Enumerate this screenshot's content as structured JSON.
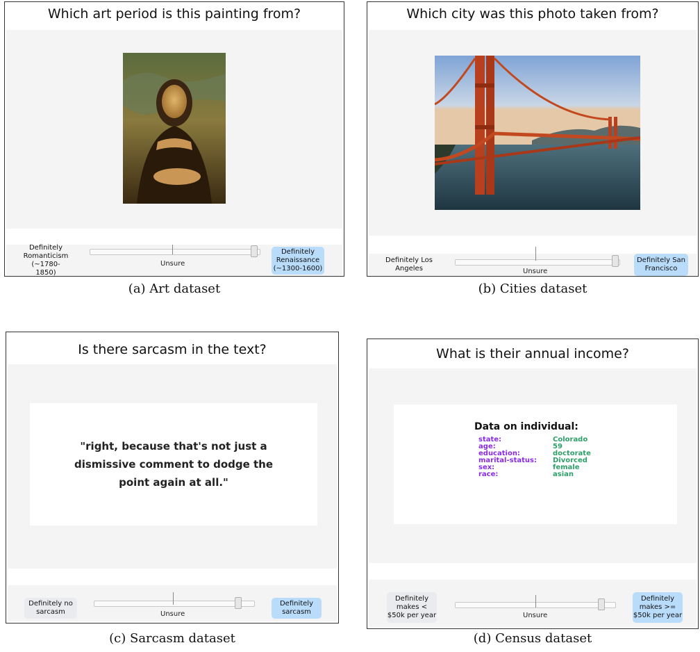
{
  "panels": [
    {
      "id": "art",
      "title": "Which art period is this painting from?",
      "left_label": "Definitely Romanticism (~1780-1850)",
      "right_label": "Definitely Renaissance (~1300-1600)",
      "center_label": "Unsure",
      "slider_value": 0.98,
      "caption": "(a) Art dataset",
      "image_semantic": "painting-mona-lisa"
    },
    {
      "id": "cities",
      "title": "Which city was this photo taken from?",
      "left_label": "Definitely Los Angeles",
      "right_label": "Definitely San Francisco",
      "center_label": "Unsure",
      "slider_value": 0.98,
      "caption": "(b) Cities dataset",
      "image_semantic": "photo-golden-gate-bridge"
    },
    {
      "id": "sarcasm",
      "title": "Is there sarcasm in the text?",
      "left_label": "Definitely no sarcasm",
      "right_label": "Definitely sarcasm",
      "center_label": "Unsure",
      "slider_value": 0.92,
      "caption": "(c) Sarcasm dataset",
      "text": "\"right, because that's not just a dismissive comment to dodge the point again at all.\""
    },
    {
      "id": "census",
      "title": "What is their annual income?",
      "left_label": "Definitely makes < $50k per year",
      "right_label": "Definitely makes >= $50k per year",
      "center_label": "Unsure",
      "slider_value": 0.9,
      "caption": "(d) Census dataset",
      "data_title": "Data on individual:",
      "rows": [
        {
          "key": "state:",
          "value": "Colorado"
        },
        {
          "key": "age:",
          "value": "59"
        },
        {
          "key": "education:",
          "value": "doctorate"
        },
        {
          "key": "marital-status:",
          "value": "Divorced"
        },
        {
          "key": "sex:",
          "value": "female"
        },
        {
          "key": "race:",
          "value": "asian"
        }
      ]
    }
  ],
  "colors": {
    "button_blue": "#b9dcfb",
    "button_gray": "#e9ebee",
    "background_gray": "#f4f4f4",
    "census_key": "#8a2be2",
    "census_value": "#2ea06a"
  }
}
